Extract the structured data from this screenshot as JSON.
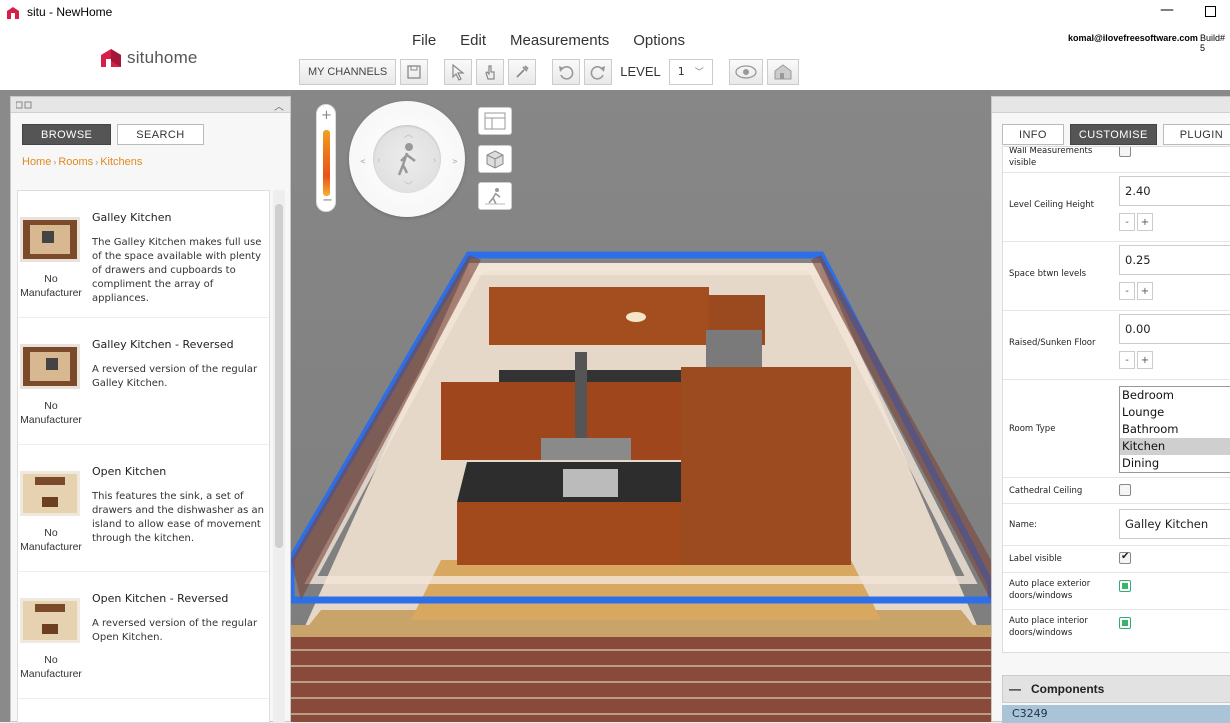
{
  "window": {
    "title": "situ - NewHome"
  },
  "header": {
    "brand": "situhome",
    "menu": [
      "File",
      "Edit",
      "Measurements",
      "Options"
    ],
    "user_email": "komal@ilovefreesoftware.com",
    "build": "Build# 5"
  },
  "toolbar": {
    "my_channels": "MY CHANNELS",
    "level_label": "LEVEL",
    "level_value": "1"
  },
  "left_panel": {
    "tabs": [
      "BROWSE",
      "SEARCH"
    ],
    "breadcrumb": [
      "Home",
      "Rooms",
      "Kitchens"
    ],
    "items": [
      {
        "title": "Galley Kitchen",
        "desc": "The Galley Kitchen makes full use of the space available with plenty of drawers and cupboards to compliment the array of appliances.",
        "manufacturer": "No Manufacturer"
      },
      {
        "title": "Galley Kitchen - Reversed",
        "desc": "A reversed version of the regular Galley Kitchen.",
        "manufacturer": "No Manufacturer"
      },
      {
        "title": "Open Kitchen",
        "desc": "This features the sink, a set of drawers and the dishwasher as an island to allow ease of movement through the kitchen.",
        "manufacturer": "No Manufacturer"
      },
      {
        "title": "Open Kitchen - Reversed",
        "desc": "A reversed version of the regular Open Kitchen.",
        "manufacturer": "No Manufacturer"
      }
    ]
  },
  "right_panel": {
    "tabs": [
      "INFO",
      "CUSTOMISE",
      "PLUGIN"
    ],
    "props": {
      "wall_measurements": "Wall Measurements visible",
      "level_ceiling_height": {
        "label": "Level Ceiling Height",
        "value": "2.40"
      },
      "space_btwn_levels": {
        "label": "Space btwn levels",
        "value": "0.25"
      },
      "raised_floor": {
        "label": "Raised/Sunken Floor",
        "value": "0.00"
      },
      "room_type": {
        "label": "Room Type",
        "options": [
          "Bedroom",
          "Lounge",
          "Bathroom",
          "Kitchen",
          "Dining"
        ],
        "selected": "Kitchen"
      },
      "cathedral_ceiling": "Cathedral Ceiling",
      "name": {
        "label": "Name:",
        "value": "Galley Kitchen"
      },
      "label_visible": "Label visible",
      "auto_exterior": "Auto place exterior doors/windows",
      "auto_interior": "Auto place interior doors/windows"
    },
    "stepper_minus": "-",
    "stepper_plus": "+",
    "components_label": "Components",
    "component_row": "C3249"
  },
  "colors": {
    "accent": "#e08a1e",
    "brand_red": "#d6204a",
    "wall_blue": "#2c6fe8"
  }
}
